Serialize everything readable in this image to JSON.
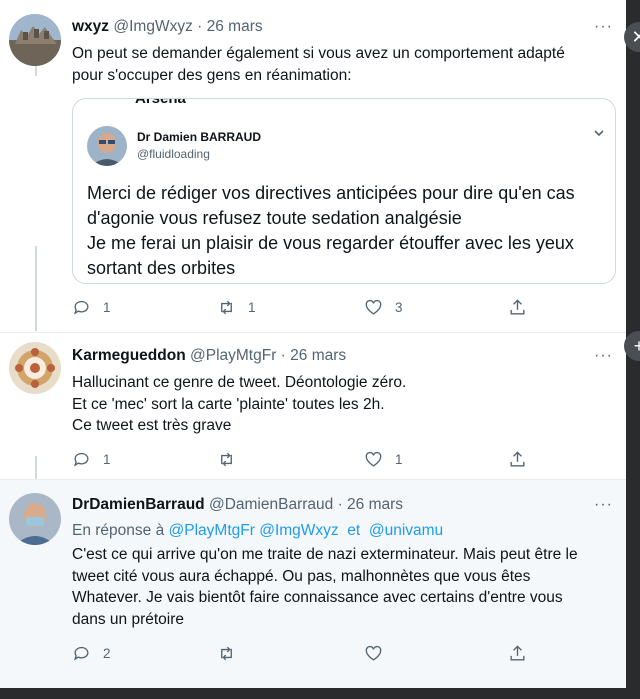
{
  "tweets": [
    {
      "name": "wxyz",
      "handle": "@ImgWxyz",
      "date": "26 mars",
      "text": "On peut se demander également si vous avez un comportement adapté\npour s'occuper des gens en réanimation:",
      "quote": {
        "peek_text": "Arsena",
        "name": "Dr Damien BARRAUD",
        "handle": "@fluidloading",
        "text": "Merci de rédiger vos directives anticipées pour dire qu'en cas\nd'agonie vous refusez toute sedation analgésie\nJe me ferai un plaisir de vous regarder étouffer avec les yeux\nsortant des orbites"
      },
      "replies": "1",
      "retweets": "1",
      "likes": "3"
    },
    {
      "name": "Karmegueddon",
      "handle": "@PlayMtgFr",
      "date": "26 mars",
      "text": "Hallucinant ce genre de tweet. Déontologie zéro.\nEt ce 'mec' sort la carte 'plainte' toutes les 2h.\nCe tweet est très grave",
      "replies": "1",
      "retweets": "",
      "likes": "1"
    },
    {
      "name": "DrDamienBarraud",
      "handle": "@DamienBarraud",
      "date": "26 mars",
      "reply_prefix": "En réponse à",
      "reply_to_1": "@PlayMtgFr",
      "reply_to_2": "@ImgWxyz",
      "reply_and": "et",
      "reply_to_3": "@univamu",
      "text": "C'est ce qui arrive qu'on me traite de nazi exterminateur. Mais peut être le\ntweet cité vous aura échappé. Ou pas, malhonnètes que vous êtes\nWhatever. Je vais bientôt faire connaissance avec certains d'entre vous\ndans un prétoire",
      "replies": "2",
      "retweets": "",
      "likes": ""
    }
  ],
  "ui": {
    "more_glyph": "···",
    "date_sep": " · ",
    "close_glyph": "✕",
    "add_glyph": "+"
  },
  "colors": {
    "accent": "#1d9bf0",
    "text": "#0f1419",
    "muted": "#536471",
    "border": "#cfd9de",
    "highlight_bg": "#f5f8fa"
  },
  "icons": [
    "reply-icon",
    "retweet-icon",
    "like-icon",
    "share-icon",
    "more-icon",
    "chevron-down-icon"
  ]
}
